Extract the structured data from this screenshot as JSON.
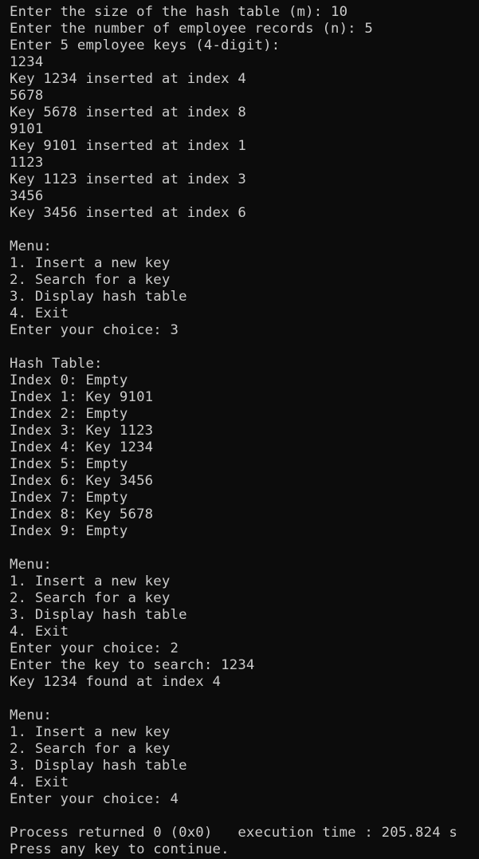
{
  "console": {
    "lines": [
      "Enter the size of the hash table (m): 10",
      "Enter the number of employee records (n): 5",
      "Enter 5 employee keys (4-digit):",
      "1234",
      "Key 1234 inserted at index 4",
      "5678",
      "Key 5678 inserted at index 8",
      "9101",
      "Key 9101 inserted at index 1",
      "1123",
      "Key 1123 inserted at index 3",
      "3456",
      "Key 3456 inserted at index 6",
      "",
      "Menu:",
      "1. Insert a new key",
      "2. Search for a key",
      "3. Display hash table",
      "4. Exit",
      "Enter your choice: 3",
      "",
      "Hash Table:",
      "Index 0: Empty",
      "Index 1: Key 9101",
      "Index 2: Empty",
      "Index 3: Key 1123",
      "Index 4: Key 1234",
      "Index 5: Empty",
      "Index 6: Key 3456",
      "Index 7: Empty",
      "Index 8: Key 5678",
      "Index 9: Empty",
      "",
      "Menu:",
      "1. Insert a new key",
      "2. Search for a key",
      "3. Display hash table",
      "4. Exit",
      "Enter your choice: 2",
      "Enter the key to search: 1234",
      "Key 1234 found at index 4",
      "",
      "Menu:",
      "1. Insert a new key",
      "2. Search for a key",
      "3. Display hash table",
      "4. Exit",
      "Enter your choice: 4",
      "",
      "Process returned 0 (0x0)   execution time : 205.824 s",
      "Press any key to continue."
    ]
  },
  "colors": {
    "background": "#0c0c0c",
    "text": "#cccccc"
  }
}
